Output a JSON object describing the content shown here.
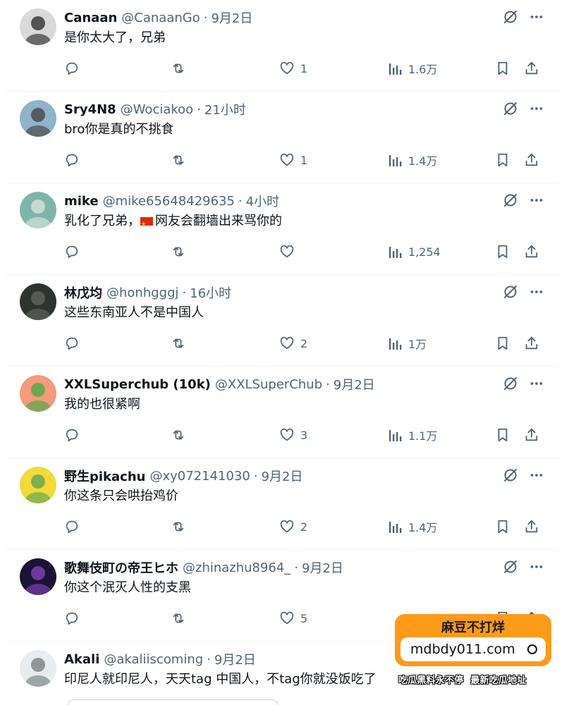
{
  "tweets": [
    {
      "name": "Canaan",
      "handle": "@CanaanGo",
      "time": "9月2日",
      "text": "是你太大了，兄弟",
      "likes": "1",
      "views": "1.6万",
      "avatar_colors": [
        "#d9d9d9",
        "#3b3b3b"
      ]
    },
    {
      "name": "Sry4N8",
      "handle": "@Wociakoo",
      "time": "21小时",
      "text": "bro你是真的不挑食",
      "likes": "1",
      "views": "1.4万",
      "avatar_colors": [
        "#8fb3c9",
        "#4a4a4a"
      ]
    },
    {
      "name": "mike",
      "handle": "@mike65648429635",
      "time": "4小时",
      "text": "网友会翻墙出来骂你的",
      "text_prefix": "乳化了兄弟，",
      "likes": "",
      "views": "1,254",
      "avatar_colors": [
        "#7fb5a8",
        "#cfe3d9"
      ]
    },
    {
      "name": "林戊均",
      "handle": "@honhgggj",
      "time": "16小时",
      "text": "这些东南亚人不是中国人",
      "likes": "2",
      "views": "1万",
      "avatar_colors": [
        "#2f332f",
        "#5c6358"
      ]
    },
    {
      "name": "XXLSuperchub (10k)",
      "handle": "@XXLSuperChub",
      "time": "9月2日",
      "text": "我的也很紧啊",
      "likes": "3",
      "views": "1.1万",
      "avatar_colors": [
        "#f59a7a",
        "#57a84a"
      ]
    },
    {
      "name": "野生pikachu",
      "handle": "@xy072141030",
      "time": "9月2日",
      "text": "你这条只会哄抬鸡价",
      "likes": "2",
      "views": "1.4万",
      "avatar_colors": [
        "#f3d93b",
        "#6aa84f"
      ]
    },
    {
      "name": "歌舞伎町の帝王ヒホ",
      "handle": "@zhinazhu8964_",
      "time": "9月2日",
      "text": "你这个泯灭人性的支黑",
      "likes": "5",
      "views": "",
      "avatar_colors": [
        "#1c1233",
        "#7b3fb3"
      ]
    },
    {
      "name": "Akali",
      "handle": "@akaliiscoming",
      "time": "9月2日",
      "text": "印尼人就印尼人，天天tag 中国人，不tag你就没饭吃了",
      "likes": "",
      "views": "",
      "avatar_colors": [
        "#e9ecef",
        "#7d8a86"
      ]
    }
  ],
  "watermark": {
    "title": "麻豆不打烊",
    "url": "mdbdy011.com",
    "line1": "吃瓜黑料永不停",
    "line2": "最新吃瓜地址"
  },
  "colors": {
    "text": "#0f1419",
    "muted": "#536471",
    "divider": "#eff3f4",
    "watermark_bg": "#ff9a1a"
  }
}
